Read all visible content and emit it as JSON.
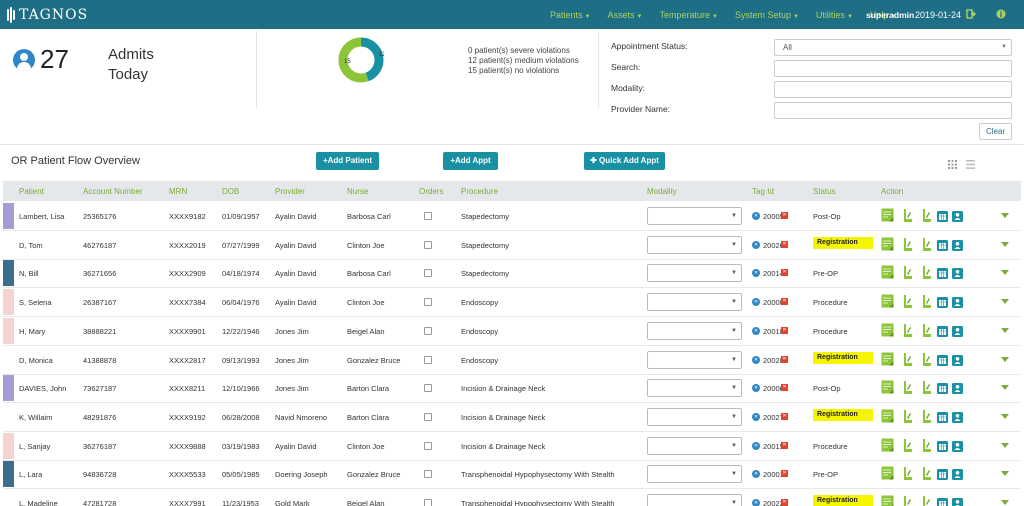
{
  "navbar": {
    "brand": "TAGNOS",
    "menu": [
      "Patients",
      "Assets",
      "Temperature",
      "System Setup",
      "Utilities",
      "Help"
    ],
    "user": "superadmin",
    "date": "2019-01-24",
    "icons": [
      "logout-icon",
      "info-icon"
    ]
  },
  "summary": {
    "admits_count": "27",
    "admits_label": "Admits",
    "admits_sub": "Today",
    "donut": {
      "severe": 0,
      "medium": 12,
      "none": 15,
      "label_medium": "12",
      "label_none": "15"
    },
    "violations": [
      "0 patient(s) severe violations",
      "12 patient(s) medium violations",
      "15 patient(s) no violations"
    ]
  },
  "filters": {
    "appointment_status_label": "Appointment Status:",
    "appointment_status_value": "All",
    "search_label": "Search:",
    "search_value": "",
    "modality_label": "Modality:",
    "modality_value": "",
    "provider_label": "Provider Name:",
    "provider_value": "",
    "clear_label": "Clear"
  },
  "overview": {
    "title": "OR Patient Flow Overview",
    "add_patient": "+Add Patient",
    "add_appt": "+Add Appt",
    "quick_add_appt": "Quick Add Appt"
  },
  "table": {
    "headers": [
      "Patient",
      "Account Number",
      "MRN",
      "DOB",
      "Provider",
      "Nurse",
      "Orders",
      "Procedure",
      "Modality",
      "Tag Id",
      "Status",
      "Action"
    ],
    "rows": [
      {
        "patient": "Lambert, Lisa",
        "account": "25365176",
        "mrn": "XXXX9182",
        "dob": "01/09/1957",
        "provider": "Ayalin David",
        "nurse": "Barbosa Carl",
        "procedure": "Stapedectomy",
        "tag": "20005",
        "status": "Post-Op",
        "highlight": false,
        "color": "#a59bd6"
      },
      {
        "patient": "D, Tom",
        "account": "46276187",
        "mrn": "XXXX2019",
        "dob": "07/27/1999",
        "provider": "Ayalin David",
        "nurse": "Clinton Joe",
        "procedure": "Stapedectomy",
        "tag": "20026",
        "status": "Registration",
        "highlight": true,
        "color": ""
      },
      {
        "patient": "N, Bill",
        "account": "36271656",
        "mrn": "XXXX2909",
        "dob": "04/18/1974",
        "provider": "Ayalin David",
        "nurse": "Barbosa Carl",
        "procedure": "Stapedectomy",
        "tag": "20014",
        "status": "Pre-OP",
        "highlight": false,
        "color": "#3b6d8d"
      },
      {
        "patient": "S, Selena",
        "account": "26387167",
        "mrn": "XXXX7384",
        "dob": "06/04/1976",
        "provider": "Ayalin David",
        "nurse": "Clinton Joe",
        "procedure": "Endoscopy",
        "tag": "20000",
        "status": "Procedure",
        "highlight": false,
        "color": "#f6d3d3"
      },
      {
        "patient": "H, Mary",
        "account": "38888221",
        "mrn": "XXXX9901",
        "dob": "12/22/1946",
        "provider": "Jones Jim",
        "nurse": "Beigel Alan",
        "procedure": "Endoscopy",
        "tag": "20018",
        "status": "Procedure",
        "highlight": false,
        "color": "#f6d3d3"
      },
      {
        "patient": "D, Monica",
        "account": "41388878",
        "mrn": "XXXX2817",
        "dob": "09/13/1993",
        "provider": "Jones Jim",
        "nurse": "Gonzalez Bruce",
        "procedure": "Endoscopy",
        "tag": "20020",
        "status": "Registration",
        "highlight": true,
        "color": ""
      },
      {
        "patient": "DAVIES, John",
        "account": "73627187",
        "mrn": "XXXX8211",
        "dob": "12/10/1966",
        "provider": "Jones Jim",
        "nurse": "Barton Clara",
        "procedure": "Incision & Drainage Neck",
        "tag": "20006",
        "status": "Post-Op",
        "highlight": false,
        "color": "#a59bd6"
      },
      {
        "patient": "K, Willaim",
        "account": "48291876",
        "mrn": "XXXX9192",
        "dob": "06/28/2008",
        "provider": "Navid Nmoreno",
        "nurse": "Barton Clara",
        "procedure": "Incision & Drainage Neck",
        "tag": "20027",
        "status": "Registration",
        "highlight": true,
        "color": ""
      },
      {
        "patient": "L, Sanjay",
        "account": "36276187",
        "mrn": "XXXX9888",
        "dob": "03/19/1983",
        "provider": "Ayalin David",
        "nurse": "Clinton Joe",
        "procedure": "Incision & Drainage Neck",
        "tag": "20015",
        "status": "Procedure",
        "highlight": false,
        "color": "#f6d3d3"
      },
      {
        "patient": "L, Lara",
        "account": "94836728",
        "mrn": "XXXX5533",
        "dob": "05/05/1985",
        "provider": "Doering Joseph",
        "nurse": "Gonzalez Bruce",
        "procedure": "Transphenoidal Hypophysectomy With Stealth",
        "tag": "20001",
        "status": "Pre-OP",
        "highlight": false,
        "color": "#3b6d8d"
      },
      {
        "patient": "L, Madeline",
        "account": "47281728",
        "mrn": "XXXX7991",
        "dob": "11/23/1953",
        "provider": "Gold Mark",
        "nurse": "Beigel Alan",
        "procedure": "Transphenoidal Hypophysectomy With Stealth",
        "tag": "20022",
        "status": "Registration",
        "highlight": true,
        "color": ""
      }
    ]
  },
  "colors": {
    "navbar": "#1e6f86",
    "accent_green": "#7cab38",
    "button_teal": "#1a90a3",
    "registration_yellow": "#f5f500",
    "donut_blue": "#1a90a3",
    "donut_green": "#8cc43a"
  }
}
